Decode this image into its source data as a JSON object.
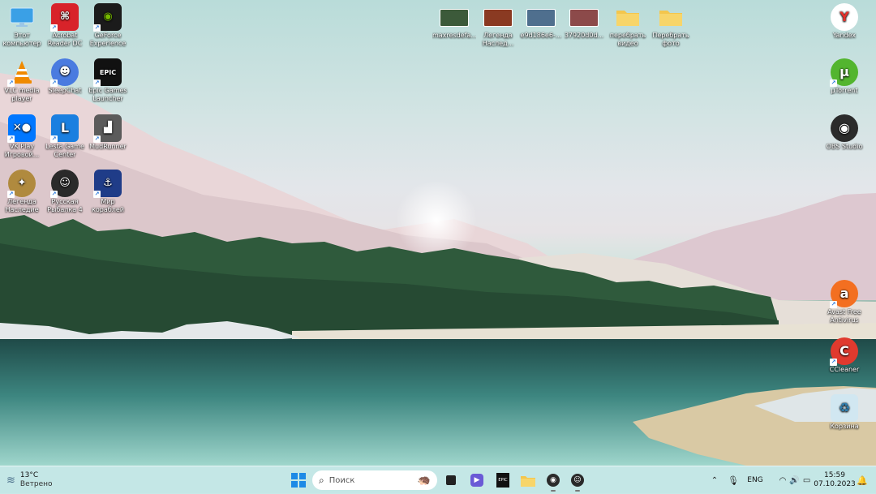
{
  "desktop_icons": [
    {
      "label": "Этот компьютер",
      "icon": "monitor-icon",
      "color": "#3aa0e6"
    },
    {
      "label": "Acrobat Reader DC",
      "icon": "acrobat-icon",
      "color": "#d8232a"
    },
    {
      "label": "GeForce Experience",
      "icon": "nvidia-icon",
      "color": "#1b1b1b"
    },
    {
      "label": "VLC media player",
      "icon": "vlc-icon",
      "color": "#f08a00"
    },
    {
      "label": "SleepChat",
      "icon": "sleepchat-icon",
      "color": "#4a7be0"
    },
    {
      "label": "Epic Games Launcher",
      "icon": "epic-games-icon",
      "color": "#111111"
    },
    {
      "label": "VK Play Игровой...",
      "icon": "vk-play-icon",
      "color": "#0077ff"
    },
    {
      "label": "Lesta Game Center",
      "icon": "lesta-icon",
      "color": "#1a7fe0"
    },
    {
      "label": "MudRunner",
      "icon": "mudrunner-icon",
      "color": "#5b5b5b"
    },
    {
      "label": "Легенда Наследие",
      "icon": "legend-icon",
      "color": "#b08a3e"
    },
    {
      "label": "Русская Рыбалка 4",
      "icon": "fishing-icon",
      "color": "#2a2a2a"
    },
    {
      "label": "Мир кораблей",
      "icon": "ships-icon",
      "color": "#1f3c88"
    }
  ],
  "top_files": [
    {
      "label": "maxresdefa...",
      "icon": "image-thumb-icon",
      "color": "#3c5a3a"
    },
    {
      "label": "Легенда Наслед...",
      "icon": "image-thumb-icon",
      "color": "#8a3a22"
    },
    {
      "label": "e9d186e6-...",
      "icon": "image-thumb-icon",
      "color": "#4f6f8e"
    },
    {
      "label": "37920d0d...",
      "icon": "image-thumb-icon",
      "color": "#8c4a4a"
    },
    {
      "label": "перебрать видео",
      "icon": "folder-icon",
      "color": "#f3c64d"
    },
    {
      "label": "Перебрать фото",
      "icon": "folder-icon",
      "color": "#f3c64d"
    }
  ],
  "right_icons": [
    {
      "label": "Yandex",
      "icon": "yandex-icon",
      "color": "#ffffff",
      "glyph": "Y"
    },
    {
      "label": "µTorrent",
      "icon": "utorrent-icon",
      "color": "#53b52f",
      "glyph": "µ"
    },
    {
      "label": "OBS Studio",
      "icon": "obs-icon",
      "color": "#2b2b2b",
      "glyph": "◉"
    },
    {
      "label": "Avast Free Antivirus",
      "icon": "avast-icon",
      "color": "#f36f21",
      "glyph": "a"
    },
    {
      "label": "CCleaner",
      "icon": "ccleaner-icon",
      "color": "#e03a2e",
      "glyph": "C"
    },
    {
      "label": "Корзина",
      "icon": "recycle-bin-icon",
      "color": "#cfe6f2",
      "glyph": "♻"
    }
  ],
  "taskbar": {
    "weather_temp": "13°C",
    "weather_desc": "Ветрено",
    "search_placeholder": "Поиск",
    "language": "ENG",
    "time": "15:59",
    "date": "07.10.2023"
  }
}
